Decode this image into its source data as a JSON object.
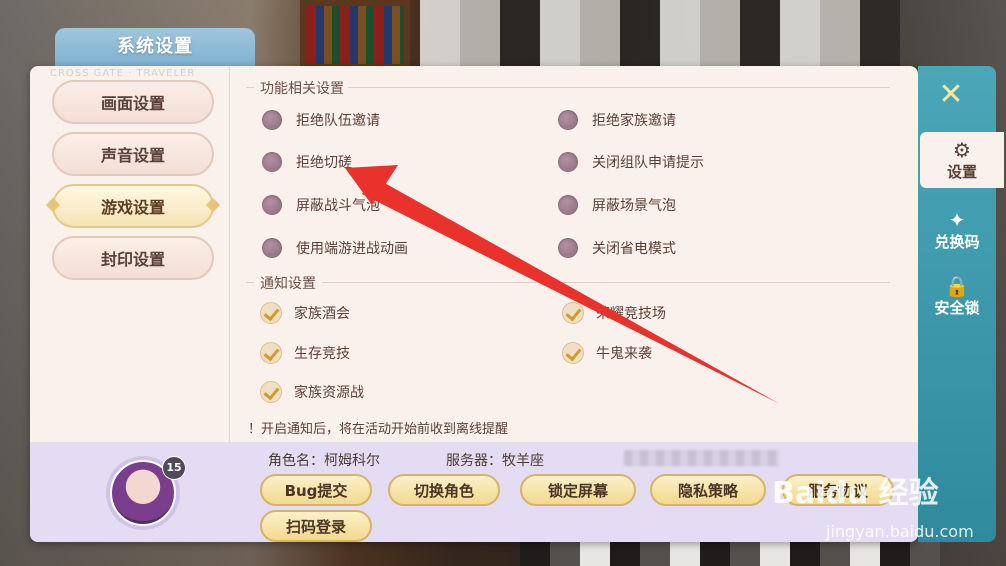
{
  "window": {
    "title": "系统设置",
    "subtitle": "CROSS GATE · TRAVELER"
  },
  "nav": {
    "items": [
      {
        "label": "画面设置"
      },
      {
        "label": "声音设置"
      },
      {
        "label": "游戏设置",
        "active": true
      },
      {
        "label": "封印设置"
      }
    ]
  },
  "sections": {
    "function": {
      "title": "功能相关设置",
      "options": [
        {
          "label": "拒绝队伍邀请"
        },
        {
          "label": "拒绝家族邀请"
        },
        {
          "label": "拒绝切磋"
        },
        {
          "label": "关闭组队申请提示"
        },
        {
          "label": "屏蔽战斗气泡"
        },
        {
          "label": "屏蔽场景气泡"
        },
        {
          "label": "使用端游进战动画"
        },
        {
          "label": "关闭省电模式"
        }
      ]
    },
    "notify": {
      "title": "通知设置",
      "options": [
        {
          "label": "家族酒会",
          "checked": true
        },
        {
          "label": "荣耀竞技场",
          "checked": true
        },
        {
          "label": "生存竞技",
          "checked": true
        },
        {
          "label": "牛鬼来袭",
          "checked": true
        },
        {
          "label": "家族资源战",
          "checked": true
        }
      ]
    },
    "notice": "！开启通知后，将在活动开始前收到离线提醒"
  },
  "profile": {
    "level": "15",
    "role_name": "角色名：柯姆科尔",
    "server": "服务器：牧羊座"
  },
  "actions": [
    "Bug提交",
    "切换角色",
    "锁定屏幕",
    "隐私策略",
    "服务协议",
    "扫码登录"
  ],
  "rail": {
    "close_icon": "close-icon",
    "items": [
      {
        "label": "设置",
        "icon": "⚙",
        "active": true
      },
      {
        "label": "兑换码",
        "icon": "✦"
      },
      {
        "label": "安全锁",
        "icon": "🔒"
      }
    ]
  },
  "watermark": {
    "logo": "Baidu 经验",
    "url": "jingyan.baidu.com"
  },
  "colors": {
    "accent_teal": "#3a98ab",
    "check_gold": "#d19a2e",
    "radio_purple": "#8a6a7b",
    "arrow_red": "#e8322b"
  }
}
